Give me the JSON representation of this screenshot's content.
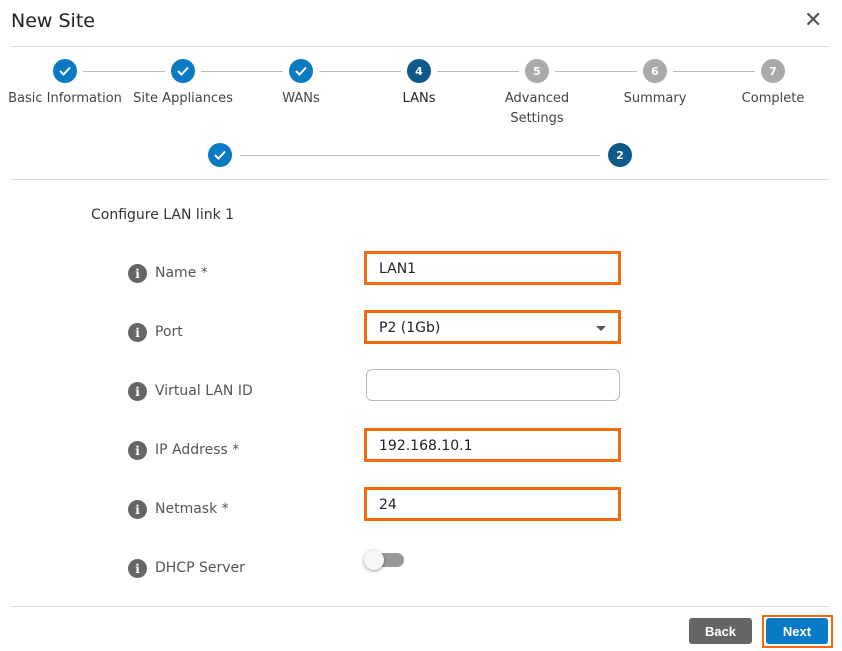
{
  "dialog": {
    "title": "New Site",
    "close_icon": "close-icon"
  },
  "steps": [
    {
      "num": "1",
      "label": "Basic Information",
      "state": "done"
    },
    {
      "num": "2",
      "label": "Site Appliances",
      "state": "done"
    },
    {
      "num": "3",
      "label": "WANs",
      "state": "done"
    },
    {
      "num": "4",
      "label": "LANs",
      "state": "current"
    },
    {
      "num": "5",
      "label": "Advanced Settings",
      "state": "todo"
    },
    {
      "num": "6",
      "label": "Summary",
      "state": "todo"
    },
    {
      "num": "7",
      "label": "Complete",
      "state": "todo"
    }
  ],
  "substeps": [
    {
      "num": "1",
      "state": "done"
    },
    {
      "num": "2",
      "state": "current"
    }
  ],
  "form": {
    "section_title": "Configure LAN link 1",
    "fields": [
      {
        "label": "Name *",
        "value": "LAN1",
        "type": "text",
        "highlighted": true
      },
      {
        "label": "Port",
        "value": "P2 (1Gb)",
        "type": "select",
        "highlighted": true
      },
      {
        "label": "Virtual LAN ID",
        "value": "",
        "type": "text",
        "highlighted": false
      },
      {
        "label": "IP Address *",
        "value": "192.168.10.1",
        "type": "text",
        "highlighted": true
      },
      {
        "label": "Netmask *",
        "value": "24",
        "type": "text",
        "highlighted": true
      },
      {
        "label": "DHCP Server",
        "value": false,
        "type": "toggle"
      }
    ]
  },
  "footer": {
    "back_label": "Back",
    "next_label": "Next"
  },
  "colors": {
    "accent": "#0a7ac4",
    "current": "#0d5a8a",
    "highlight": "#f26a10",
    "back": "#666666"
  }
}
